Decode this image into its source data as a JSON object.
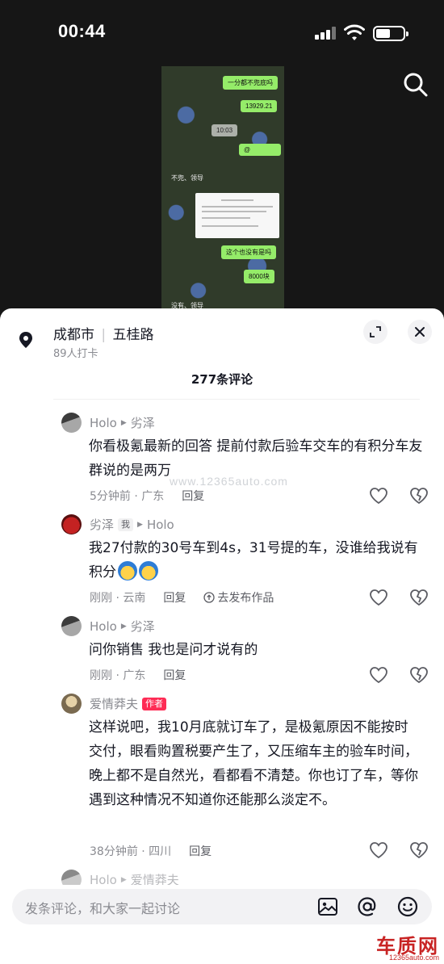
{
  "status": {
    "time": "00:44"
  },
  "video": {
    "bubbles": [
      "一分都不兜底吗",
      "13929.21",
      "10:03",
      "@",
      "不兜、领导",
      "这个也没有是吗",
      "8000块",
      "没有、领导"
    ]
  },
  "location": {
    "city": "成都市",
    "road": "五桂路",
    "checkins": "89人打卡"
  },
  "comments_header": {
    "count": "277条评论"
  },
  "comments": [
    {
      "author": "Holo",
      "reply_to": "劣泽",
      "text": "你看极氪最新的回答  提前付款后验车交车的有积分车友群说的是两万",
      "time_loc": "5分钟前 · 广东",
      "reply": "回复"
    },
    {
      "author": "劣泽",
      "tag": "我",
      "reply_to": "Holo",
      "text": "我27付款的30号车到4s，31号提的车，没谁给我说有积分",
      "time_loc": "刚刚 · 云南",
      "reply": "回复",
      "publish": "去发布作品"
    },
    {
      "author": "Holo",
      "reply_to": "劣泽",
      "text": "问你销售 我也是问才说有的",
      "time_loc": "刚刚 · 广东",
      "reply": "回复"
    },
    {
      "author": "爱情莽夫",
      "tag": "作者",
      "text": "这样说吧，我10月底就订车了，是极氪原因不能按时交付，眼看购置税要产生了，又压缩车主的验车时间，晚上都不是自然光，看都看不清楚。你也订了车，等你遇到这种情况不知道你还能那么淡定不。",
      "time_loc": "38分钟前 · 四川",
      "reply": "回复"
    },
    {
      "author": "Holo",
      "reply_to": "爱情莽夫"
    }
  ],
  "input": {
    "placeholder": "发条评论，和大家一起讨论"
  },
  "watermark": {
    "mid": "www.12365auto.com",
    "logo": "车质网",
    "logo_url": "12365auto.com"
  },
  "icons": [
    "search-icon",
    "location-pin-icon",
    "expand-icon",
    "close-icon",
    "like-icon",
    "dislike-icon",
    "image-icon",
    "at-icon",
    "emoji-icon"
  ]
}
